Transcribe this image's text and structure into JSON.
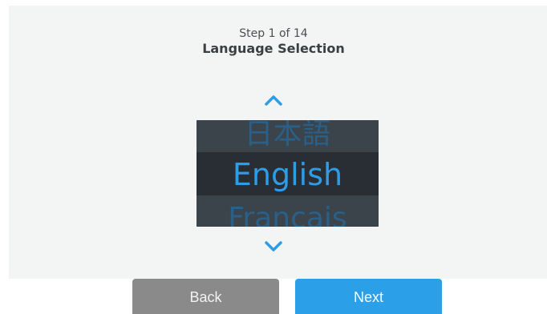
{
  "header": {
    "step": "Step 1 of 14",
    "title": "Language Selection"
  },
  "picker": {
    "previous": "日本語",
    "selected": "English",
    "next": "Francais"
  },
  "buttons": {
    "back": "Back",
    "next": "Next"
  },
  "icons": {
    "scroll_up": "chevron-up-icon",
    "scroll_down": "chevron-down-icon"
  },
  "colors": {
    "accent": "#2f9ce6",
    "picker_bg": "#3f474f",
    "selected_row_bg": "#282e33",
    "back_button": "#8a8a8a",
    "next_button": "#2b9fe8"
  }
}
